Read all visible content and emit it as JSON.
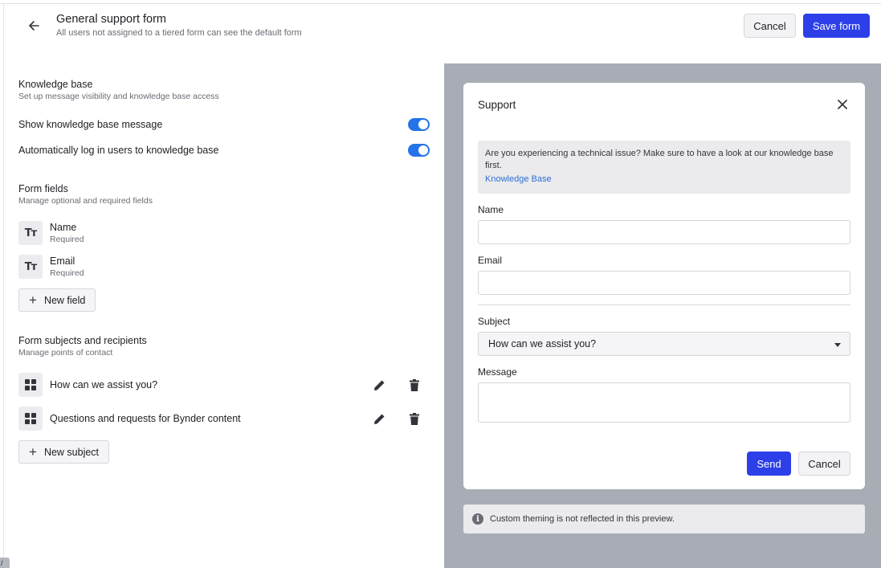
{
  "header": {
    "title": "General support form",
    "subtitle": "All users not assigned to a tiered form can see the default form",
    "cancel_label": "Cancel",
    "save_label": "Save form"
  },
  "knowledge_base": {
    "title": "Knowledge base",
    "subtitle": "Set up message visibility and knowledge base access",
    "toggles": [
      {
        "label": "Show knowledge base message",
        "on": true
      },
      {
        "label": "Automatically log in users to knowledge base",
        "on": true
      }
    ]
  },
  "form_fields": {
    "title": "Form fields",
    "subtitle": "Manage optional and required fields",
    "fields": [
      {
        "name": "Name",
        "status": "Required",
        "icon": "text-type-icon"
      },
      {
        "name": "Email",
        "status": "Required",
        "icon": "text-type-icon"
      }
    ],
    "new_field_label": "New field"
  },
  "subjects": {
    "title": "Form subjects and recipients",
    "subtitle": "Manage points of contact",
    "items": [
      {
        "label": "How can we assist you?"
      },
      {
        "label": "Questions and requests for Bynder content"
      }
    ],
    "new_subject_label": "New subject"
  },
  "preview": {
    "modal_title": "Support",
    "info_text": "Are you experiencing a technical issue? Make sure to have a look at our knowledge base first.",
    "info_link": "Knowledge Base",
    "name_label": "Name",
    "email_label": "Email",
    "subject_label": "Subject",
    "subject_value": "How can we assist you?",
    "message_label": "Message",
    "send_label": "Send",
    "cancel_label": "Cancel",
    "notice": "Custom theming is not reflected in this preview."
  },
  "colors": {
    "primary": "#2c3fe8",
    "toggle_on": "#2573e8",
    "preview_backdrop": "#a8adb5",
    "link": "#2b6fd6"
  }
}
